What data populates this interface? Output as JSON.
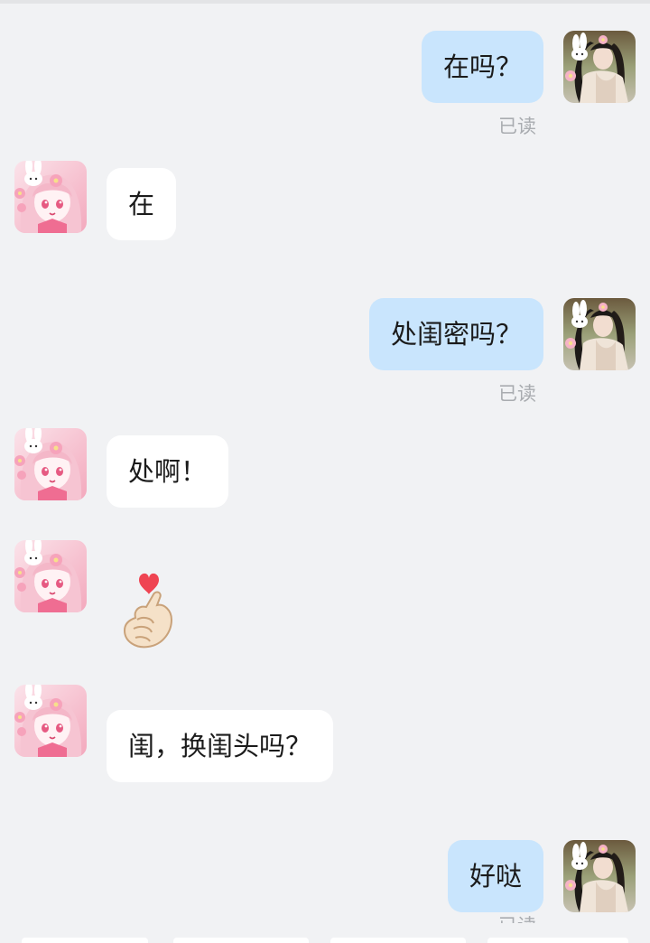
{
  "colors": {
    "background": "#f1f2f4",
    "self_bubble": "#c9e5fd",
    "friend_bubble": "#ffffff",
    "receipt_text": "#a9acb0"
  },
  "messages": [
    {
      "sender": "self",
      "type": "text",
      "text": "在吗？",
      "receipt": "已读"
    },
    {
      "sender": "friend",
      "type": "text",
      "text": "在"
    },
    {
      "sender": "self",
      "type": "text",
      "text": "处闺密吗？",
      "receipt": "已读"
    },
    {
      "sender": "friend",
      "type": "text",
      "text": "处啊！"
    },
    {
      "sender": "friend",
      "type": "sticker",
      "icon": "finger-heart-icon"
    },
    {
      "sender": "friend",
      "type": "text",
      "text": "闺，换闺头吗？"
    },
    {
      "sender": "self",
      "type": "text",
      "text": "好哒",
      "receipt": "已读"
    }
  ]
}
